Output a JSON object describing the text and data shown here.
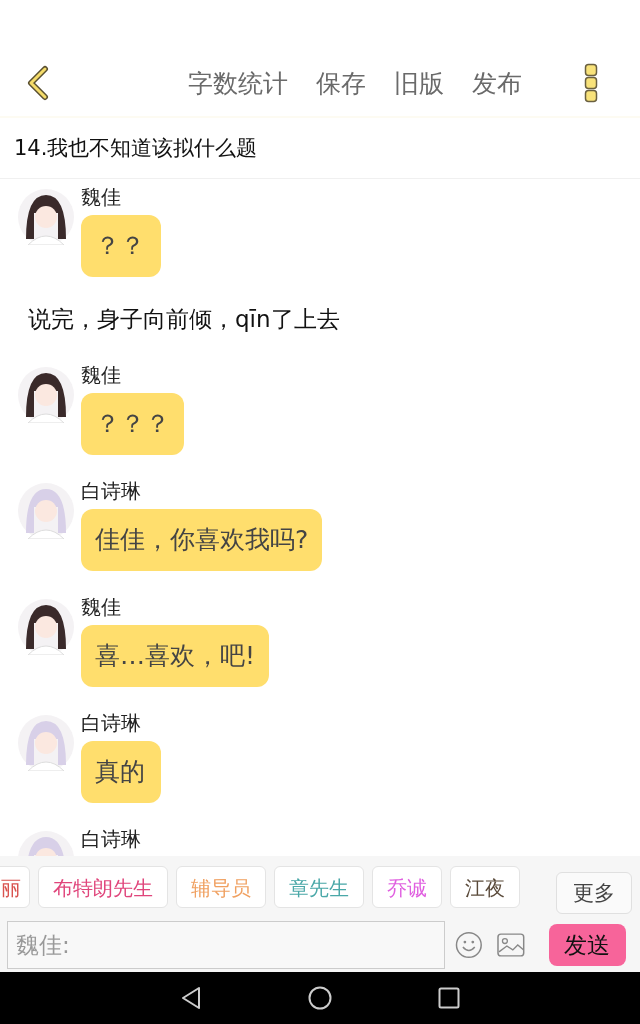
{
  "header": {
    "actions": [
      "字数统计",
      "保存",
      "旧版",
      "发布"
    ]
  },
  "chapter_title": "14.我也不知道该拟什么题",
  "messages": [
    {
      "kind": "message",
      "name": "魏佳",
      "text": "？？",
      "color": "#3a2a2a"
    },
    {
      "kind": "narration",
      "text": "说完，身子向前倾，qīn了上去"
    },
    {
      "kind": "message",
      "name": "魏佳",
      "text": "？？？",
      "color": "#3a2a2a"
    },
    {
      "kind": "message",
      "name": "白诗琳",
      "text": "佳佳，你喜欢我吗?",
      "color": "#d8d0e8"
    },
    {
      "kind": "message",
      "name": "魏佳",
      "text": "喜…喜欢，吧!",
      "color": "#3a2a2a"
    },
    {
      "kind": "message",
      "name": "白诗琳",
      "text": "真的",
      "color": "#d8d0e8"
    },
    {
      "kind": "message",
      "name": "白诗琳",
      "color": "#d8d0e8"
    }
  ],
  "characters": [
    {
      "name": "丽",
      "color": "#d9534f"
    },
    {
      "name": "布特朗先生",
      "color": "#e0457b"
    },
    {
      "name": "辅导员",
      "color": "#f0a060"
    },
    {
      "name": "章先生",
      "color": "#4aa8a8"
    },
    {
      "name": "乔诚",
      "color": "#e060e0"
    },
    {
      "name": "江夜",
      "color": "#5a4a3a"
    }
  ],
  "more_button": "更多",
  "input": {
    "placeholder": "魏佳:"
  },
  "send_button": "发送"
}
